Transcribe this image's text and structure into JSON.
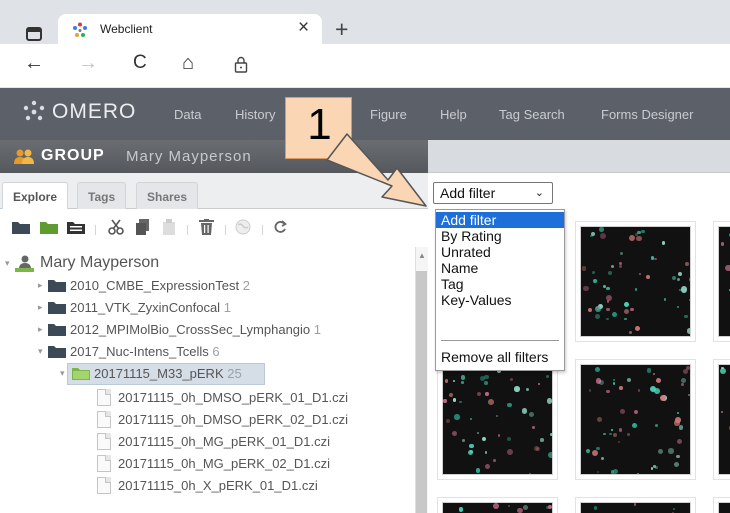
{
  "browser": {
    "tab_title": "Webclient",
    "tab_close": "×",
    "new_tab": "+",
    "nav": {
      "back": "←",
      "forward": "→",
      "reload": "C",
      "home": "⌂"
    }
  },
  "omero": {
    "logo_text": "OMERO",
    "menu": [
      "Data",
      "History",
      "Figure",
      "Help",
      "Tag Search",
      "Forms Designer"
    ]
  },
  "group_bar": {
    "label": "GROUP",
    "user": "Mary Mayperson"
  },
  "left_tabs": [
    "Explore",
    "Tags",
    "Shares"
  ],
  "tree": {
    "root": "Mary Mayperson",
    "projects": [
      {
        "name": "2010_CMBE_ExpressionTest",
        "count": "2"
      },
      {
        "name": "2011_VTK_ZyxinConfocal",
        "count": "1"
      },
      {
        "name": "2012_MPIMolBio_CrossSec_Lymphangio",
        "count": "1"
      },
      {
        "name": "2017_Nuc-Intens_Tcells",
        "count": "6"
      }
    ],
    "dataset": {
      "name": "20171115_M33_pERK",
      "count": "25"
    },
    "files": [
      "20171115_0h_DMSO_pERK_01_D1.czi",
      "20171115_0h_DMSO_pERK_02_D1.czi",
      "20171115_0h_MG_pERK_01_D1.czi",
      "20171115_0h_MG_pERK_02_D1.czi",
      "20171115_0h_X_pERK_01_D1.czi"
    ]
  },
  "filter": {
    "selected": "Add filter",
    "options": [
      "Add filter",
      "By Rating",
      "Unrated",
      "Name",
      "Tag",
      "Key-Values"
    ],
    "remove_all": "Remove all filters"
  },
  "annotation": {
    "step": "1"
  },
  "colors": {
    "header": "#5c6068",
    "highlight": "#1e6fd9",
    "callout": "#fad6b5",
    "folder": "#3c4a57",
    "folder_selected": "#7ab648"
  }
}
